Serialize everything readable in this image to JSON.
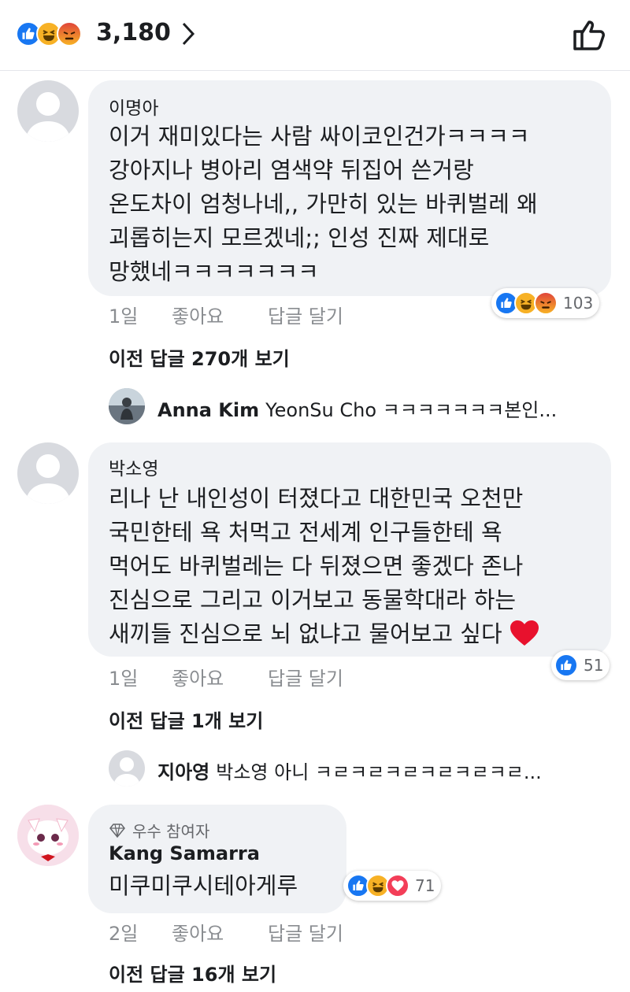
{
  "header": {
    "reaction_total": "3,180",
    "reaction_icons": [
      "like-icon",
      "haha-icon",
      "angry-icon"
    ]
  },
  "colors": {
    "like": "#1877f2",
    "haha": "#f7b125",
    "angry": "#e9710f",
    "love": "#f33e58",
    "bubble": "#f0f2f5",
    "meta_text": "#8a8d91"
  },
  "comments": [
    {
      "author": "이명아",
      "lines": [
        "이거 재미있다는 사람 싸이코인건가ㅋㅋㅋㅋ",
        "강아지나 병아리 염색약 뒤집어 쓴거랑",
        "온도차이 엄청나네,, 가만히 있는 바퀴벌레 왜",
        "괴롭히는지 모르겠네;; 인성 진짜 제대로",
        "망했네ㅋㅋㅋㅋㅋㅋㅋ"
      ],
      "time": "1일",
      "like_label": "좋아요",
      "reply_label": "답글 달기",
      "reaction_count": "103",
      "reaction_icons": [
        "like-icon",
        "haha-icon",
        "angry-icon"
      ],
      "prev_replies": {
        "prefix": "이전 답글 ",
        "count": "270",
        "suffix": "개 보기"
      },
      "last_reply": {
        "author": "Anna Kim",
        "text": "YeonSu Cho ㅋㅋㅋㅋㅋㅋㅋ본인..."
      }
    },
    {
      "author": "박소영",
      "lines": [
        "리나 난 내인성이 터졌다고 대한민국 오천만",
        "국민한테 욕 처먹고 전세계 인구들한테 욕",
        "먹어도 바퀴벌레는 다 뒤졌으면 좋겠다 존나",
        "진심으로 그리고 이거보고 동물학대라 하는",
        "새끼들 진심으로 뇌 없냐고 물어보고 싶다"
      ],
      "time": "1일",
      "like_label": "좋아요",
      "reply_label": "답글 달기",
      "reaction_count": "51",
      "reaction_icons": [
        "like-icon"
      ],
      "prev_replies": {
        "prefix": "이전 답글 ",
        "count": "1",
        "suffix": "개 보기"
      },
      "last_reply": {
        "author": "지아영",
        "text": "박소영 아니 ㅋㄹㅋㄹㅋㄹㅋㄹㅋㄹㅋㄹ..."
      }
    },
    {
      "badge": "우수 참여자",
      "author": "Kang Samarra",
      "lines": [
        "미쿠미쿠시테아게루"
      ],
      "time": "2일",
      "like_label": "좋아요",
      "reply_label": "답글 달기",
      "reaction_count": "71",
      "reaction_icons": [
        "like-icon",
        "haha-icon",
        "love-icon"
      ],
      "prev_replies": {
        "prefix": "이전 답글 ",
        "count": "16",
        "suffix": "개 보기"
      }
    }
  ]
}
